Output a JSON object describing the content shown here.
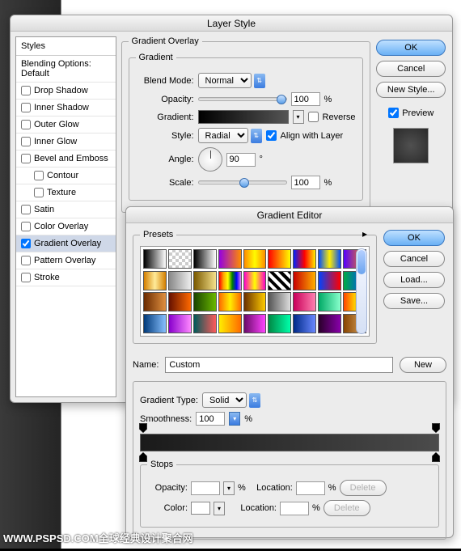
{
  "layerStyle": {
    "title": "Layer Style",
    "stylesHeader": "Styles",
    "blendingOptions": "Blending Options: Default",
    "effects": [
      {
        "label": "Drop Shadow",
        "checked": false
      },
      {
        "label": "Inner Shadow",
        "checked": false
      },
      {
        "label": "Outer Glow",
        "checked": false
      },
      {
        "label": "Inner Glow",
        "checked": false
      },
      {
        "label": "Bevel and Emboss",
        "checked": false
      },
      {
        "label": "Contour",
        "checked": false,
        "indent": true
      },
      {
        "label": "Texture",
        "checked": false,
        "indent": true
      },
      {
        "label": "Satin",
        "checked": false
      },
      {
        "label": "Color Overlay",
        "checked": false
      },
      {
        "label": "Gradient Overlay",
        "checked": true,
        "selected": true
      },
      {
        "label": "Pattern Overlay",
        "checked": false
      },
      {
        "label": "Stroke",
        "checked": false
      }
    ],
    "panelTitle": "Gradient Overlay",
    "gradientGroup": "Gradient",
    "blendModeLabel": "Blend Mode:",
    "blendModeValue": "Normal",
    "opacityLabel": "Opacity:",
    "opacityValue": "100",
    "gradientLabel": "Gradient:",
    "reverseLabel": "Reverse",
    "styleLabel": "Style:",
    "styleValue": "Radial",
    "alignLabel": "Align with Layer",
    "angleLabel": "Angle:",
    "angleValue": "90",
    "scaleLabel": "Scale:",
    "scaleValue": "100",
    "percent": "%",
    "degree": "°",
    "buttons": {
      "ok": "OK",
      "cancel": "Cancel",
      "newStyle": "New Style...",
      "preview": "Preview"
    }
  },
  "gradientEditor": {
    "title": "Gradient Editor",
    "presetsLabel": "Presets",
    "nameLabel": "Name:",
    "nameValue": "Custom",
    "newBtn": "New",
    "typeLabel": "Gradient Type:",
    "typeValue": "Solid",
    "smoothLabel": "Smoothness:",
    "smoothValue": "100",
    "percent": "%",
    "stopsLabel": "Stops",
    "stopOpacityLabel": "Opacity:",
    "stopLocationLabel": "Location:",
    "stopColorLabel": "Color:",
    "deleteBtn": "Delete",
    "buttons": {
      "ok": "OK",
      "cancel": "Cancel",
      "load": "Load...",
      "save": "Save..."
    },
    "presets": [
      "linear-gradient(to right,#000,#fff)",
      "repeating-conic-gradient(#ccc 0 25%,#fff 0 50%) 0/8px 8px",
      "linear-gradient(to right,#000,#fff)",
      "linear-gradient(to right,#9500e0,#ff8c00)",
      "linear-gradient(to right,#ff8c00,#fffb00,#ff8c00)",
      "linear-gradient(to right,#ff0000,#ffff00)",
      "linear-gradient(to right,#0022ff,#ff0000,#ffee00)",
      "linear-gradient(to right,#004cff,#ffee00,#004cff)",
      "linear-gradient(to right,#5500ff,#ff8800)",
      "linear-gradient(to right,#d47f00,#ffeb99,#d47f00)",
      "linear-gradient(to right,#888,#eee)",
      "linear-gradient(to right,#7a5a00,#f5e08a)",
      "linear-gradient(to right,red,orange,yellow,green,blue,violet)",
      "linear-gradient(to right,#ff00cc,#ffff00,#ff00cc)",
      "repeating-linear-gradient(45deg,#000 0 4px,#fff 4px 8px)",
      "linear-gradient(to right,#c80000,#ffb000)",
      "linear-gradient(to right,#0044ff,#ff0000)",
      "linear-gradient(to right,#00aa44,#004cff)",
      "linear-gradient(to right,#6a2a00,#e09040)",
      "linear-gradient(to right,#661100,#ff6a00)",
      "linear-gradient(to right,#1a4400,#6ab800)",
      "linear-gradient(to right,#ff6a00,#ffee00,#ff6a00)",
      "linear-gradient(to right,#6a3000,#ffcc00)",
      "linear-gradient(to right,#555,#ddd)",
      "linear-gradient(to right,#c8005a,#ff80b0)",
      "linear-gradient(to right,#00aa66,#88ffcc)",
      "linear-gradient(to right,#ff4400,#ffcc00,#004cff)",
      "linear-gradient(to right,#003a7a,#88c0ff)",
      "linear-gradient(to right,#8800cc,#ff88ff)",
      "linear-gradient(to right,#005a5a,#ff5a5a)",
      "linear-gradient(to right,#ffee00,#ff6a00)",
      "linear-gradient(to right,#6a0a6a,#ff44ff)",
      "linear-gradient(to right,#008844,#00ffaa)",
      "linear-gradient(to right,#002a88,#6a88ff)",
      "linear-gradient(to right,#2a002a,#8800aa)",
      "linear-gradient(to right,#884400,#ddaa66)"
    ]
  },
  "watermark": "WWW.PSPSD.COM全球经典设计聚合网"
}
